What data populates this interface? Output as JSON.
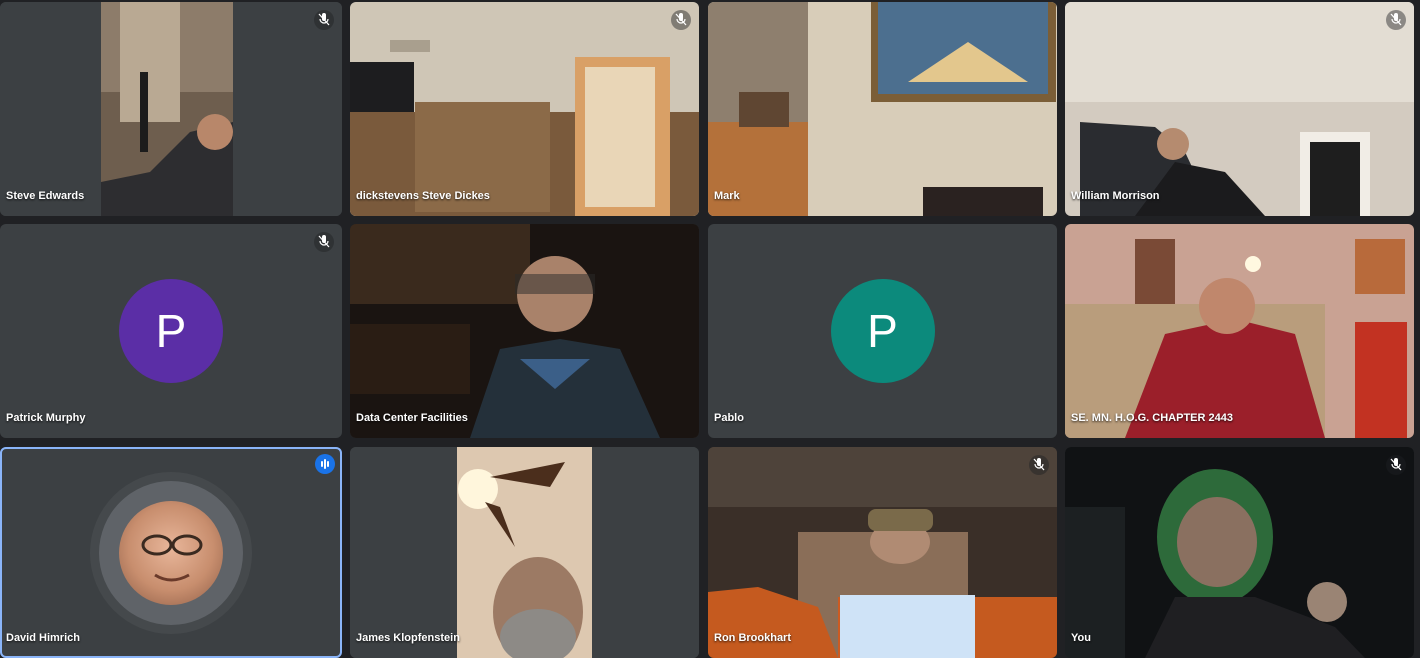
{
  "participants": [
    {
      "name": "Steve Edwards",
      "muted": true
    },
    {
      "name": "dickstevens Steve Dickes",
      "muted": true
    },
    {
      "name": "Mark",
      "muted": false
    },
    {
      "name": "William Morrison",
      "muted": true
    },
    {
      "name": "Patrick Murphy",
      "muted": true,
      "avatar_letter": "P",
      "avatar_color": "#5b2ea6"
    },
    {
      "name": "Data Center Facilities",
      "muted": false
    },
    {
      "name": "Pablo",
      "muted": false,
      "avatar_letter": "P",
      "avatar_color": "#0c8a7c"
    },
    {
      "name": "SE. MN. H.O.G. CHAPTER 2443",
      "muted": false
    },
    {
      "name": "David Himrich",
      "muted": false,
      "speaking": true
    },
    {
      "name": "James Klopfenstein",
      "muted": false
    },
    {
      "name": "Ron Brookhart",
      "muted": true
    },
    {
      "name": "You",
      "muted": true
    }
  ],
  "colors": {
    "background": "#202124",
    "tile": "#3c4043",
    "speaking_outline": "#8ab4f8",
    "speaking_badge": "#1a73e8"
  }
}
